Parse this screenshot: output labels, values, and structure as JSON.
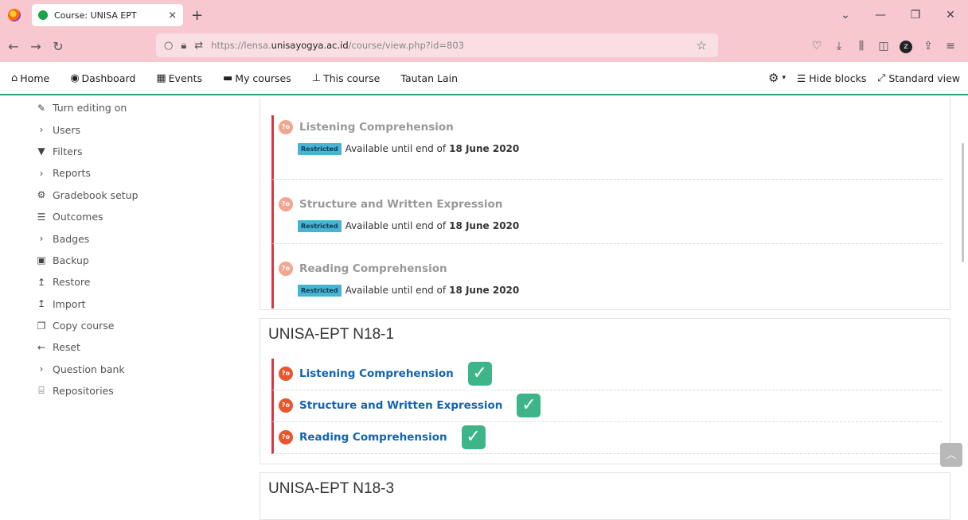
{
  "browser": {
    "tab_title": "Course: UNISA EPT",
    "tab_close": "×",
    "new_tab": "+",
    "url_prefix": "https://lensa.",
    "url_domain": "unisayogya.ac.id",
    "url_path": "/course/view.php?id=803"
  },
  "topnav": {
    "home": "Home",
    "dashboard": "Dashboard",
    "events": "Events",
    "my_courses": "My courses",
    "this_course": "This course",
    "tautan_lain": "Tautan Lain",
    "hide_blocks": "Hide blocks",
    "standard_view": "Standard view"
  },
  "admin_menu": [
    {
      "icon": "pencil-icon",
      "label": "Turn editing on"
    },
    {
      "icon": "chevron-right-icon",
      "label": "Users"
    },
    {
      "icon": "filter-icon",
      "label": "Filters"
    },
    {
      "icon": "chevron-right-icon",
      "label": "Reports"
    },
    {
      "icon": "gear-icon",
      "label": "Gradebook setup"
    },
    {
      "icon": "outcomes-icon",
      "label": "Outcomes"
    },
    {
      "icon": "chevron-right-icon",
      "label": "Badges"
    },
    {
      "icon": "backup-icon",
      "label": "Backup"
    },
    {
      "icon": "restore-icon",
      "label": "Restore"
    },
    {
      "icon": "import-icon",
      "label": "Import"
    },
    {
      "icon": "copy-icon",
      "label": "Copy course"
    },
    {
      "icon": "arrow-left-icon",
      "label": "Reset"
    },
    {
      "icon": "chevron-right-icon",
      "label": "Question bank"
    },
    {
      "icon": "repository-icon",
      "label": "Repositories"
    }
  ],
  "restricted_section": {
    "activities": [
      {
        "name": "Listening Comprehension"
      },
      {
        "name": "Structure and Written Expression"
      },
      {
        "name": "Reading Comprehension"
      }
    ],
    "badge": "Restricted",
    "restriction_text": "Available until end of",
    "restriction_date": "18 June 2020"
  },
  "section_n18_1": {
    "title": "UNISA-EPT N18-1",
    "activities": [
      {
        "name": "Listening Comprehension",
        "completed": true
      },
      {
        "name": "Structure and Written Expression",
        "completed": true
      },
      {
        "name": "Reading Comprehension",
        "completed": true
      }
    ]
  },
  "section_n18_3": {
    "title": "UNISA-EPT N18-3"
  },
  "colors": {
    "browser_chrome": "#f7c8cf",
    "nav_underline": "#2aa37c",
    "activity_border": "#d9363e",
    "link": "#1164b4",
    "check": "#3eb489",
    "restricted_badge": "#49b3d4"
  }
}
